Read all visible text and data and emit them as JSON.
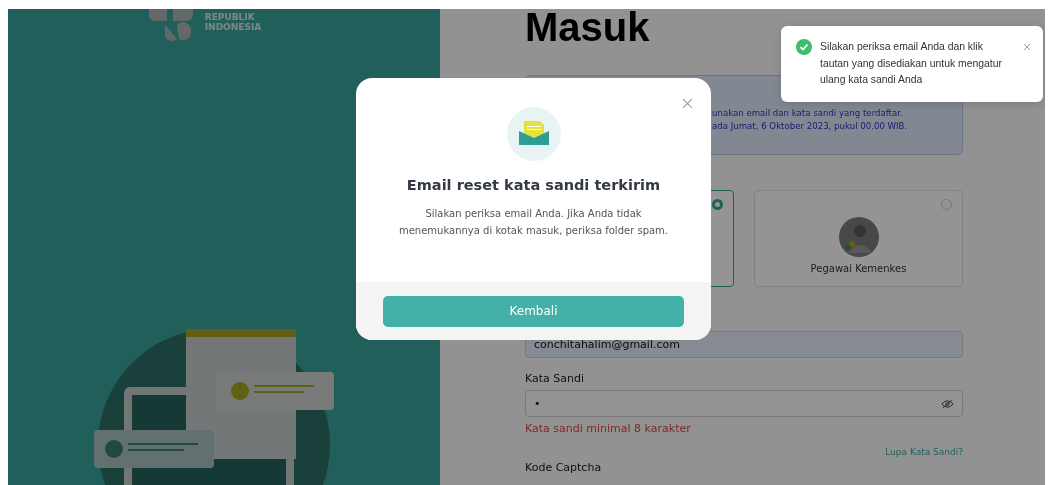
{
  "brand": {
    "lines": [
      "REPUBLIK",
      "INDONESIA"
    ]
  },
  "login": {
    "title": "Masuk",
    "notice": [
      "unakan email dan kata sandi yang terdaftar.",
      "ada Jumat, 6 Oktober 2023, pukul 00.00 WIB."
    ],
    "roles": [
      {
        "selected": true
      },
      {
        "label": "Pegawai Kemenkes",
        "selected": false
      }
    ],
    "email": {
      "value": "conchitahalim@gmail.com"
    },
    "password": {
      "label": "Kata Sandi",
      "value": "•",
      "error": "Kata sandi minimal 8 karakter"
    },
    "forgot_link": "Lupa Kata Sandi?",
    "captcha_label": "Kode Captcha"
  },
  "toast": {
    "message": "Silakan periksa email Anda dan klik tautan yang disediakan untuk mengatur ulang kata sandi Anda"
  },
  "modal": {
    "title": "Email reset kata sandi terkirim",
    "body": "Silakan periksa email Anda. Jika Anda tidak menemukannya di kotak masuk, periksa folder spam.",
    "button": "Kembali"
  }
}
